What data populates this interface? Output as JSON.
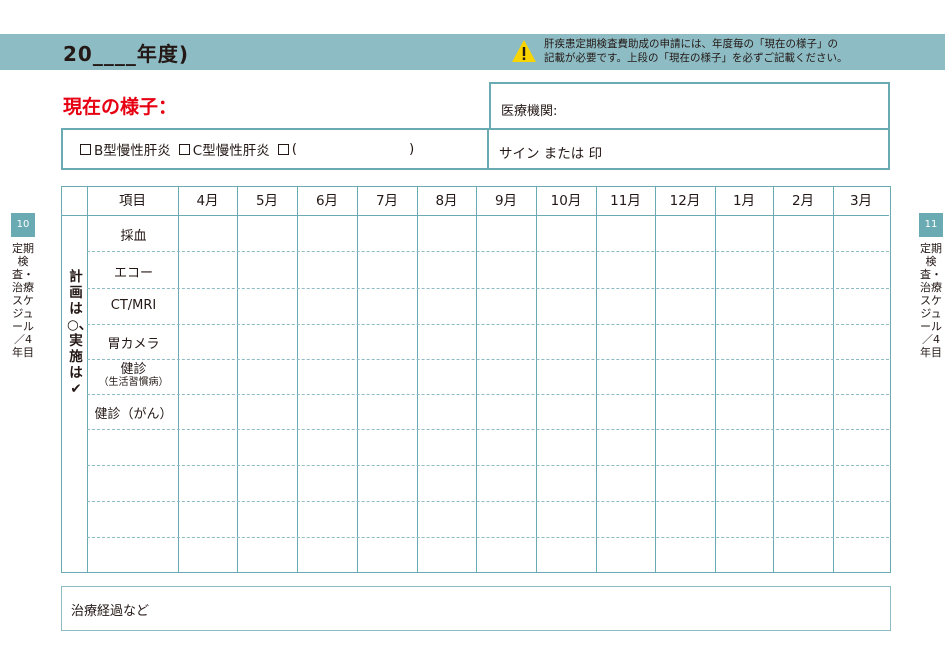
{
  "header": {
    "year_label": "20____年度)",
    "notice_line1": "肝疾患定期検査費助成の申請には、年度毎の「現在の様子」の",
    "notice_line2": "記載が必要です。上段の「現在の様子」を必ずご記載ください。",
    "warning_icon": "warning-triangle-icon",
    "band_color": "#8dbcc4"
  },
  "status": {
    "title": "現在の様子：",
    "title_color": "#e60012",
    "hospital_label": "医療機関:",
    "sign_label": "サイン または 印",
    "conditions": [
      "B型慢性肝炎",
      "C型慢性肝炎",
      "("
    ],
    "condition_close": ")"
  },
  "schedule": {
    "item_header": "項目",
    "months": [
      "4月",
      "5月",
      "6月",
      "7月",
      "8月",
      "9月",
      "10月",
      "11月",
      "12月",
      "1月",
      "2月",
      "3月"
    ],
    "plan_label": "計画は○、実施は✔",
    "items": [
      "採血",
      "エコー",
      "CT/MRI",
      "胃カメラ",
      "健診",
      "健診（がん）"
    ],
    "item_sub": "（生活習慣病）"
  },
  "notes": {
    "label": "治療経過など"
  },
  "side": {
    "left_page": "10",
    "right_page": "11",
    "text": "定期検査・治療スケジュール／4年目"
  }
}
